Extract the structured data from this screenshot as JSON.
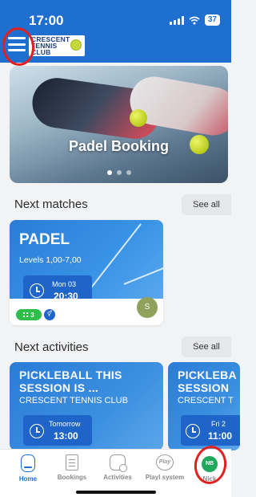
{
  "status_bar": {
    "time": "17:00",
    "battery": "37"
  },
  "header": {
    "logo_lines": [
      "CRESCENT",
      "TENNIS",
      "CLUB"
    ]
  },
  "banner": {
    "title": "Padel Booking",
    "dots": 3,
    "active_dot": 0
  },
  "next_matches": {
    "title": "Next matches",
    "see_all": "See all",
    "card": {
      "title": "PADEL",
      "levels": "Levels 1,00-7,00",
      "day": "Mon 03",
      "time": "20:30",
      "player_count": "3",
      "avatar_initial": "S"
    }
  },
  "next_activities": {
    "title": "Next activities",
    "see_all": "See all",
    "cards": [
      {
        "title_line1": "PICKLEBALL THIS",
        "title_line2": "SESSION IS ...",
        "club": "CRESCENT TENNIS CLUB",
        "day": "Tomorrow",
        "time": "13:00"
      },
      {
        "title_line1": "PICKLEBA",
        "title_line2": "SESSION",
        "club": "CRESCENT T",
        "day": "Fri 2",
        "time": "11:00"
      }
    ]
  },
  "bottom_nav": {
    "items": [
      {
        "label": "Home",
        "icon": "home-icon",
        "active": true
      },
      {
        "label": "Bookings",
        "icon": "calendar-icon",
        "active": false
      },
      {
        "label": "Activities",
        "icon": "activities-icon",
        "active": false
      },
      {
        "label": "Playl system",
        "icon": "play-icon",
        "active": false
      },
      {
        "label": "Nick",
        "icon": "avatar",
        "initials": "NB",
        "active": false
      }
    ]
  },
  "colors": {
    "brand_blue": "#1f6fd1",
    "green": "#2dbf4a",
    "annotation_red": "#e0211f"
  }
}
